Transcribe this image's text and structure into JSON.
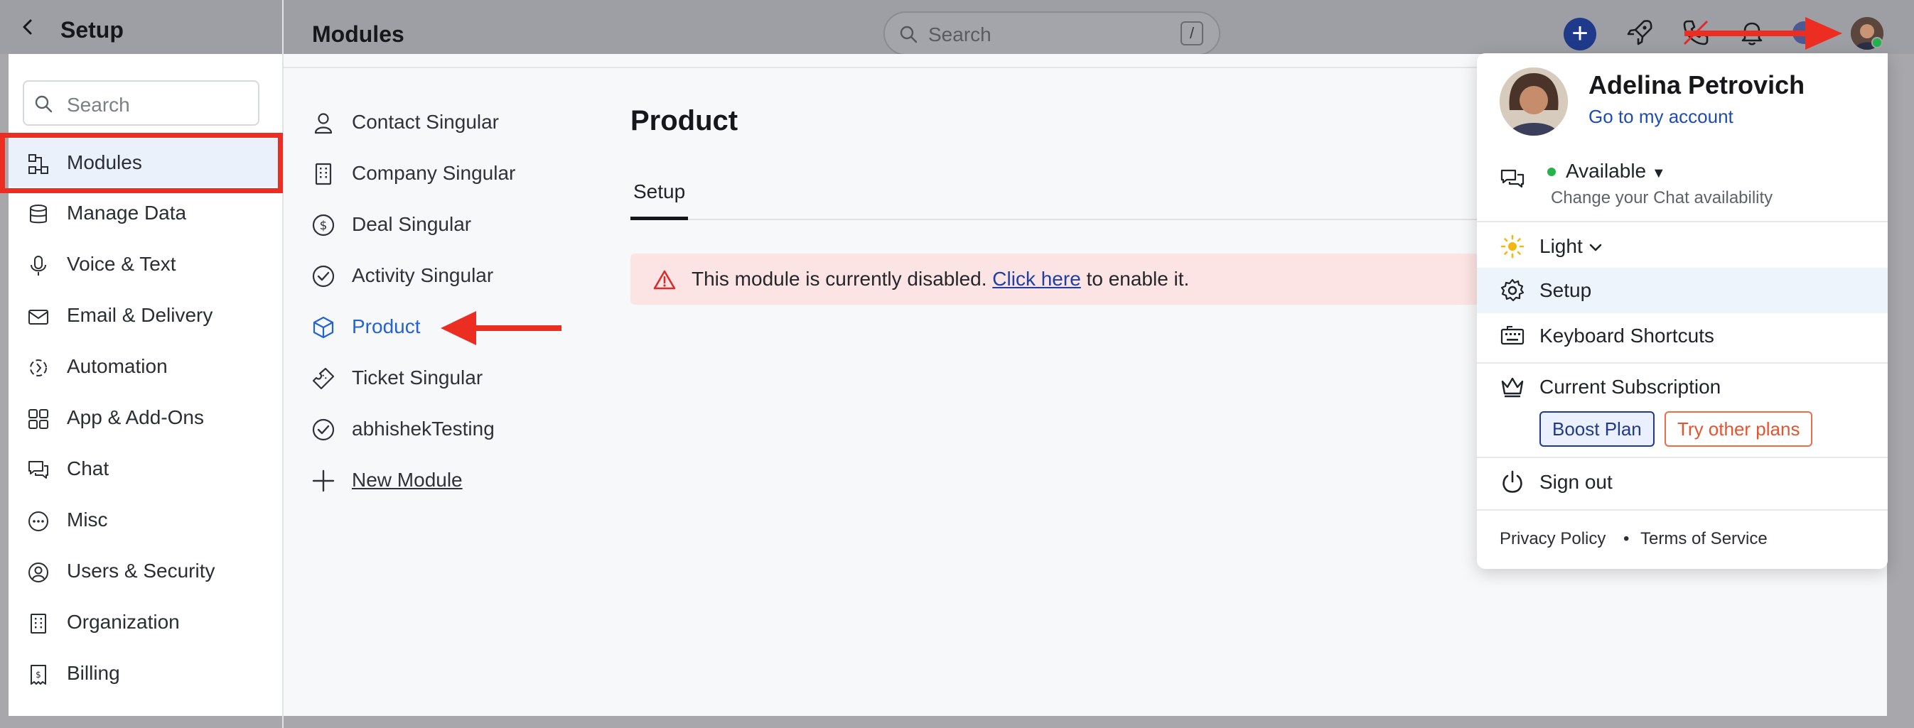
{
  "header": {
    "left_title": "Setup",
    "main_title": "Modules",
    "search_placeholder": "Search",
    "search_shortcut": "/"
  },
  "sidebar": {
    "search_placeholder": "Search",
    "items": [
      {
        "label": "Modules",
        "icon": "modules-icon",
        "active": true
      },
      {
        "label": "Manage Data",
        "icon": "database-icon"
      },
      {
        "label": "Voice & Text",
        "icon": "microphone-icon"
      },
      {
        "label": "Email & Delivery",
        "icon": "mail-icon"
      },
      {
        "label": "Automation",
        "icon": "automation-icon"
      },
      {
        "label": "App & Add-Ons",
        "icon": "apps-grid-icon"
      },
      {
        "label": "Chat",
        "icon": "chat-icon"
      },
      {
        "label": "Misc",
        "icon": "more-icon"
      },
      {
        "label": "Users & Security",
        "icon": "user-circle-icon"
      },
      {
        "label": "Organization",
        "icon": "building-icon"
      },
      {
        "label": "Billing",
        "icon": "billing-icon"
      }
    ]
  },
  "modules": {
    "items": [
      {
        "label": "Contact Singular",
        "icon": "person-icon"
      },
      {
        "label": "Company Singular",
        "icon": "building-icon"
      },
      {
        "label": "Deal Singular",
        "icon": "dollar-icon"
      },
      {
        "label": "Activity Singular",
        "icon": "check-circle-icon"
      },
      {
        "label": "Product",
        "icon": "box-icon",
        "active": true
      },
      {
        "label": "Ticket Singular",
        "icon": "ticket-icon"
      },
      {
        "label": "abhishekTesting",
        "icon": "check-circle-icon"
      }
    ],
    "new_module": "New Module"
  },
  "product": {
    "title": "Product",
    "tab": "Setup",
    "alert_before": "This module is currently disabled.",
    "alert_link": "Click here",
    "alert_after": "to enable it."
  },
  "profile_menu": {
    "name": "Adelina Petrovich",
    "account_link": "Go to my account",
    "status": "Available",
    "status_hint": "Change your Chat availability",
    "theme": "Light",
    "setup": "Setup",
    "shortcuts": "Keyboard Shortcuts",
    "subscription": "Current Subscription",
    "boost_plan": "Boost Plan",
    "try_plans": "Try other plans",
    "sign_out": "Sign out",
    "privacy": "Privacy Policy",
    "terms": "Terms of Service",
    "footer_sep": "•"
  },
  "colors": {
    "accent": "#2463d6",
    "highlight": "#ec2d22",
    "alert_bg": "#fde4e4",
    "status_green": "#27b24a"
  }
}
